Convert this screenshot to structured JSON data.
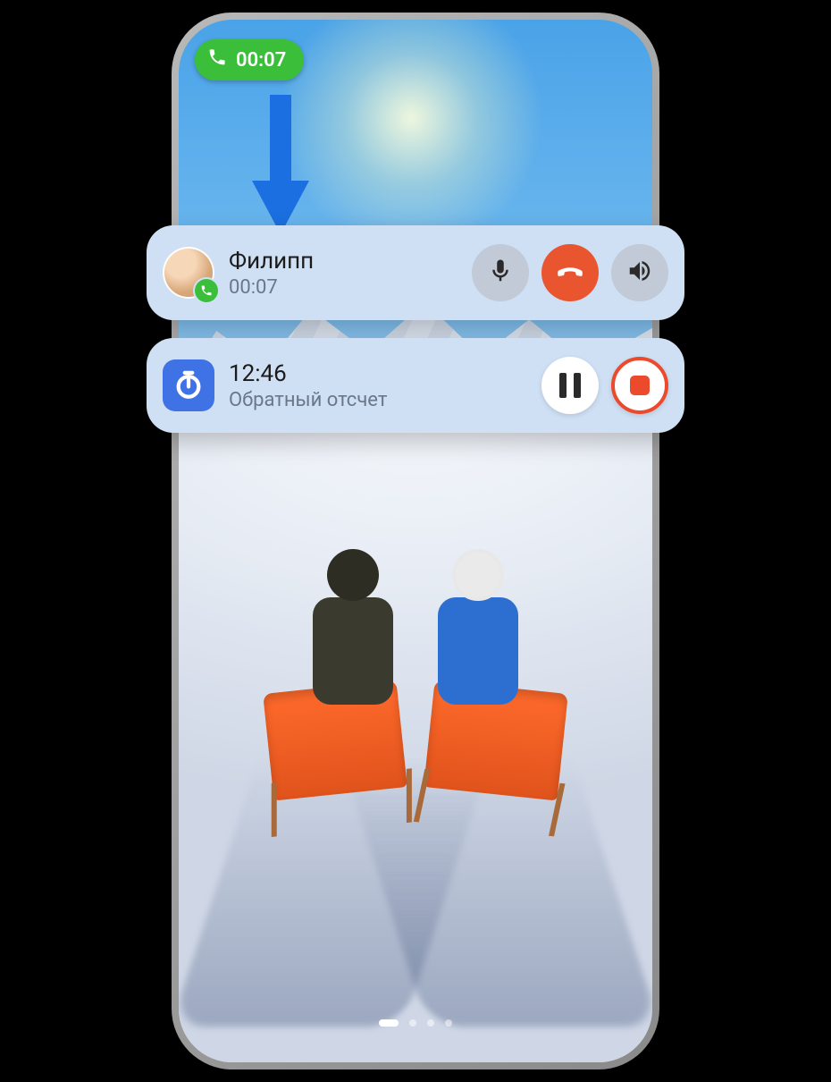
{
  "status_pill": {
    "duration": "00:07"
  },
  "call_card": {
    "name": "Филипп",
    "duration": "00:07"
  },
  "timer_card": {
    "time": "12:46",
    "label": "Обратный отсчет"
  },
  "colors": {
    "pill_green": "#3bbf3b",
    "card_bg": "#cfe0f4",
    "hangup_red": "#e9552f",
    "record_red": "#ec4a2c",
    "timer_blue": "#3f72e4",
    "arrow_blue": "#1b6fe0"
  }
}
